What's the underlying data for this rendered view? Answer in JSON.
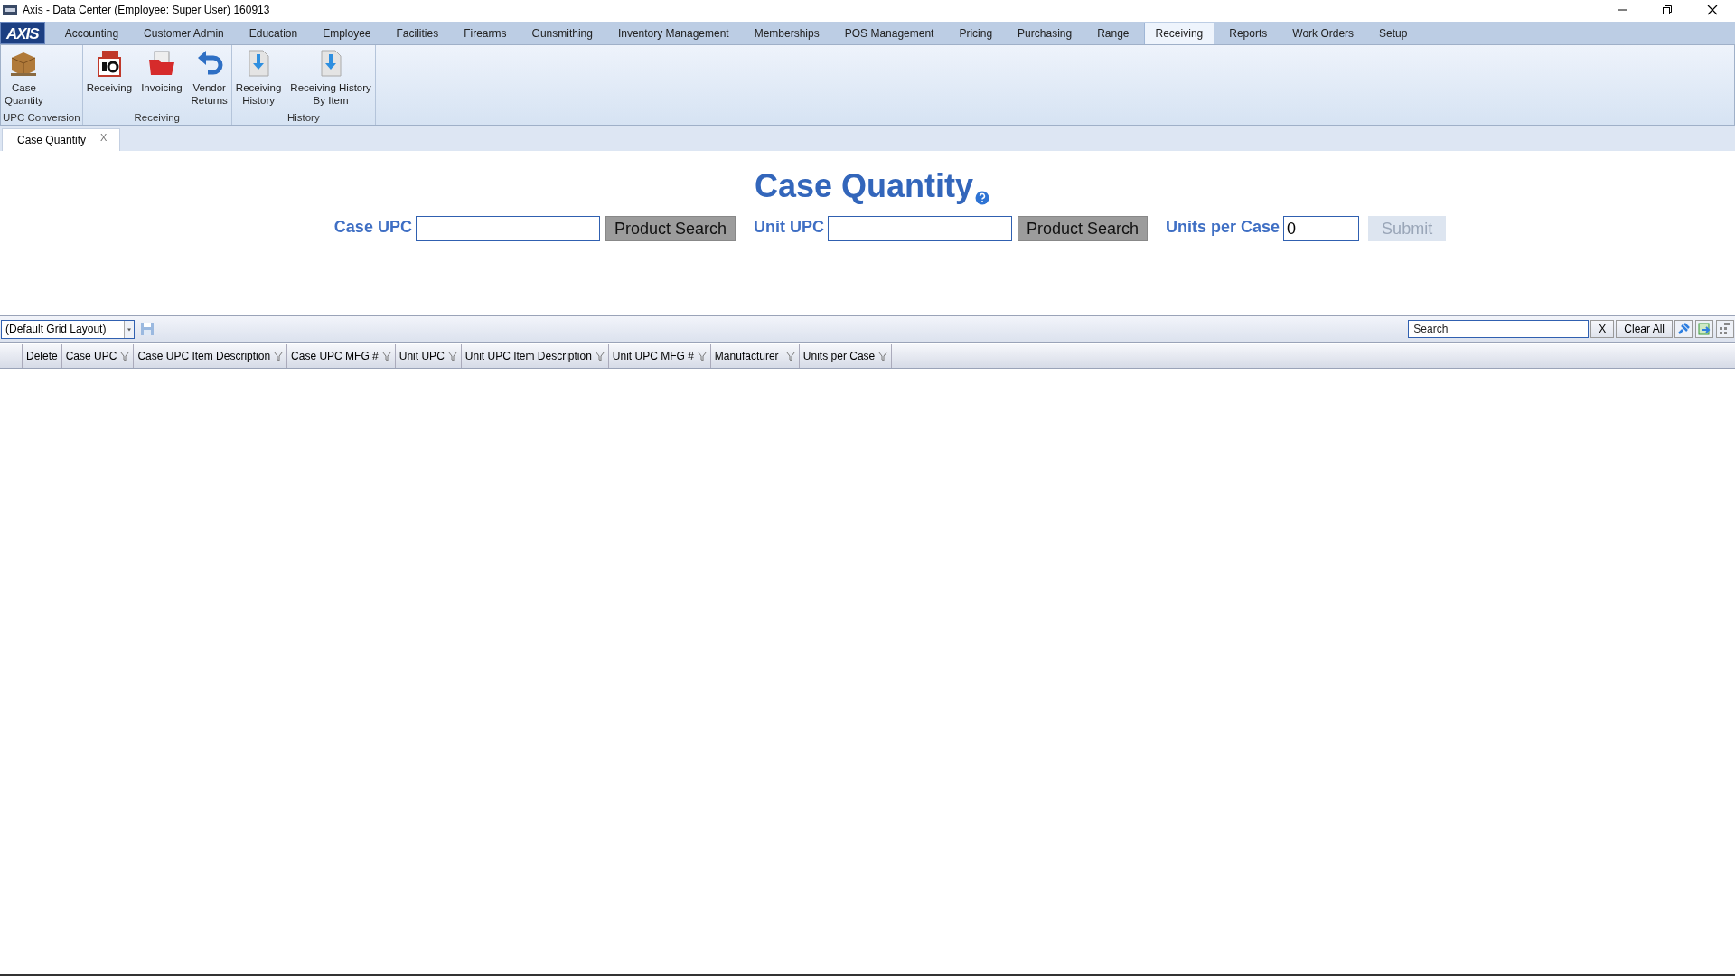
{
  "window": {
    "title": "Axis - Data Center  (Employee: Super User) 160913"
  },
  "menu": {
    "logo": "AXIS",
    "items": [
      {
        "label": "Accounting",
        "selected": false
      },
      {
        "label": "Customer Admin",
        "selected": false
      },
      {
        "label": "Education",
        "selected": false
      },
      {
        "label": "Employee",
        "selected": false
      },
      {
        "label": "Facilities",
        "selected": false
      },
      {
        "label": "Firearms",
        "selected": false
      },
      {
        "label": "Gunsmithing",
        "selected": false
      },
      {
        "label": "Inventory Management",
        "selected": false
      },
      {
        "label": "Memberships",
        "selected": false
      },
      {
        "label": "POS Management",
        "selected": false
      },
      {
        "label": "Pricing",
        "selected": false
      },
      {
        "label": "Purchasing",
        "selected": false
      },
      {
        "label": "Range",
        "selected": false
      },
      {
        "label": "Receiving",
        "selected": true
      },
      {
        "label": "Reports",
        "selected": false
      },
      {
        "label": "Work Orders",
        "selected": false
      },
      {
        "label": "Setup",
        "selected": false
      }
    ]
  },
  "ribbon": {
    "groups": [
      {
        "label": "UPC Conversion",
        "buttons": [
          {
            "label": "Case\nQuantity",
            "kind": "box"
          }
        ]
      },
      {
        "label": "Receiving",
        "buttons": [
          {
            "label": "Receiving",
            "kind": "po"
          },
          {
            "label": "Invoicing",
            "kind": "folder"
          },
          {
            "label": "Vendor\nReturns",
            "kind": "undo"
          }
        ]
      },
      {
        "label": "History",
        "buttons": [
          {
            "label": "Receiving\nHistory",
            "kind": "download"
          },
          {
            "label": "Receiving History\nBy Item",
            "kind": "download"
          }
        ]
      }
    ]
  },
  "doc_tabs": [
    {
      "label": "Case Quantity",
      "close": "X",
      "selected": true
    }
  ],
  "form": {
    "title": "Case Quantity",
    "fields": [
      {
        "kind": "input",
        "label": "Case UPC"
      },
      {
        "kind": "button",
        "label": "Product Search",
        "disabled": false
      },
      {
        "kind": "input",
        "label": "Unit UPC"
      },
      {
        "kind": "button",
        "label": "Product Search",
        "disabled": false
      },
      {
        "kind": "input",
        "label": "Units per Case",
        "value": "0"
      },
      {
        "kind": "button",
        "label": "Submit",
        "disabled": true
      }
    ]
  },
  "grid": {
    "layout": "(Default Grid Layout)",
    "search": {
      "placeholder": "Search"
    },
    "clear_search": "X",
    "clear_all": "Clear All",
    "columns": [
      {
        "label": "Delete",
        "filter": false
      },
      {
        "label": "Case UPC",
        "filter": true
      },
      {
        "label": "Case UPC Item Description",
        "filter": true
      },
      {
        "label": "Case UPC MFG #",
        "filter": true
      },
      {
        "label": "Unit UPC",
        "filter": true
      },
      {
        "label": "Unit UPC Item Description",
        "filter": true
      },
      {
        "label": "Unit UPC MFG #",
        "filter": true
      },
      {
        "label": "Manufacturer",
        "filter": true
      },
      {
        "label": "Units per Case",
        "filter": true
      }
    ]
  }
}
